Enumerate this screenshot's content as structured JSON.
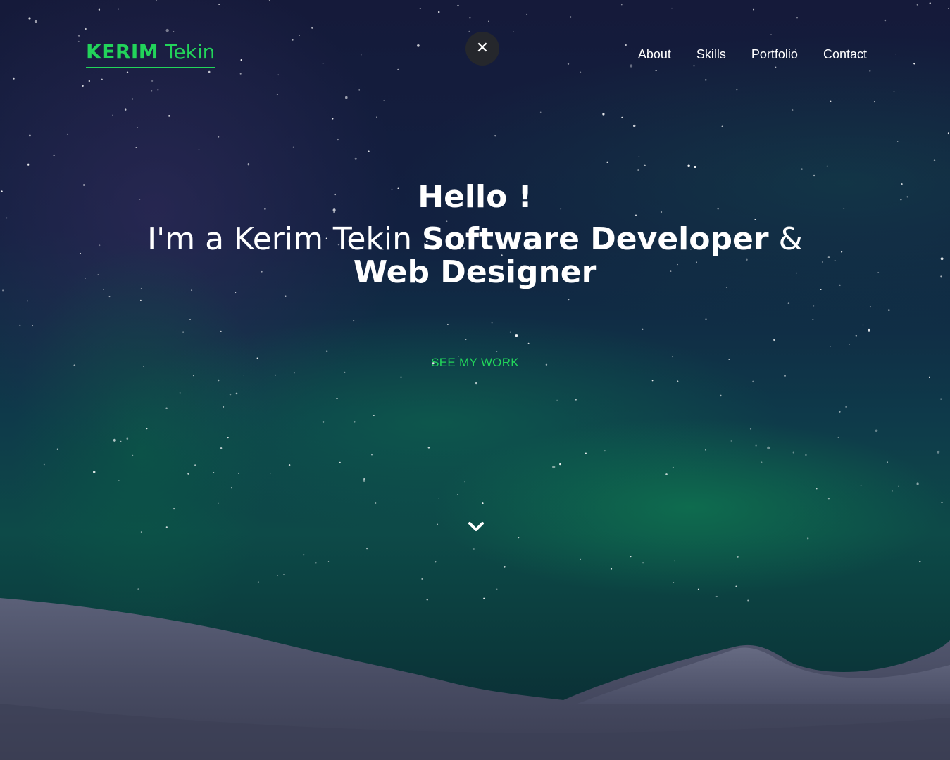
{
  "brand": {
    "first": "KERIM",
    "last": "Tekin",
    "color": "#22d45a"
  },
  "close_button": {
    "icon": "close-icon",
    "glyph": "✕"
  },
  "nav": {
    "items": [
      {
        "label": "About"
      },
      {
        "label": "Skills"
      },
      {
        "label": "Portfolio"
      },
      {
        "label": "Contact"
      }
    ]
  },
  "hero": {
    "greeting": "Hello !",
    "intro_prefix": "I'm a Kerim Tekin ",
    "role_1": "Software Developer",
    "connector": " &",
    "role_2": "Web Designer",
    "cta_label": "SEE MY WORK",
    "scroll_icon": "chevron-down-icon"
  }
}
